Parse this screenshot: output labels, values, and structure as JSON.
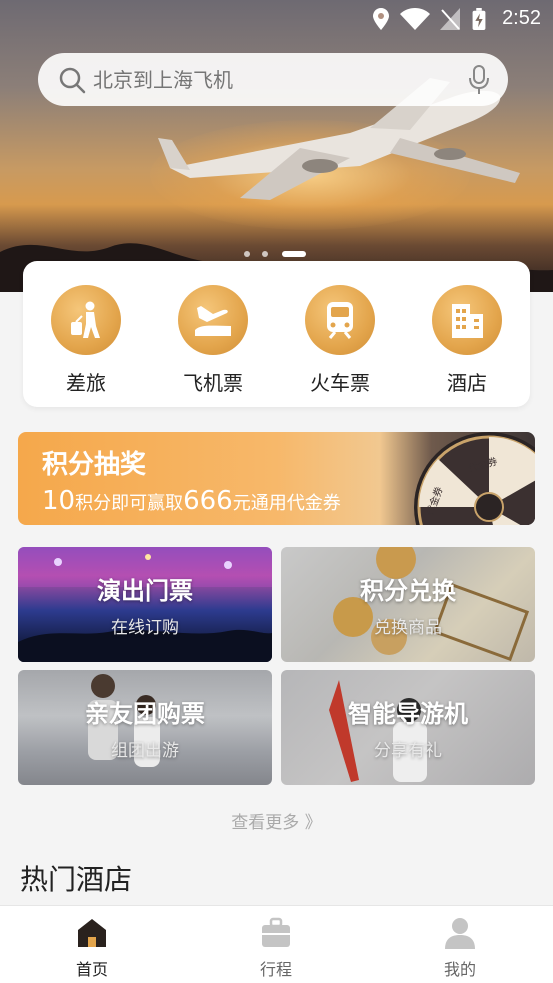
{
  "status": {
    "time": "2:52"
  },
  "search": {
    "placeholder": "北京到上海飞机"
  },
  "banner": {
    "slide_count": 3,
    "active_index": 2
  },
  "categories": [
    {
      "label": "差旅",
      "icon": "traveler-icon"
    },
    {
      "label": "飞机票",
      "icon": "airplane-landing-icon"
    },
    {
      "label": "火车票",
      "icon": "train-icon"
    },
    {
      "label": "酒店",
      "icon": "hotel-building-icon"
    }
  ],
  "promo": {
    "title": "积分抽奖",
    "sub_num1": "10",
    "sub_text1": "积分即可赢取",
    "sub_num2": "666",
    "sub_text2": "元通用代金券",
    "wheel_label": "代金券"
  },
  "tiles": [
    {
      "title": "演出门票",
      "subtitle": "在线订购"
    },
    {
      "title": "积分兑换",
      "subtitle": "兑换商品"
    },
    {
      "title": "亲友团购票",
      "subtitle": "组团出游"
    },
    {
      "title": "智能导游机",
      "subtitle": "分享有礼"
    }
  ],
  "more_label": "查看更多 》",
  "hot_hotels_title": "热门酒店",
  "tabs": [
    {
      "label": "首页",
      "icon": "home-icon",
      "active": true
    },
    {
      "label": "行程",
      "icon": "briefcase-icon",
      "active": false
    },
    {
      "label": "我的",
      "icon": "user-icon",
      "active": false
    }
  ],
  "colors": {
    "accent_gold": "#e3a54c",
    "promo_orange": "#f5a84b",
    "text_dark": "#222222"
  }
}
